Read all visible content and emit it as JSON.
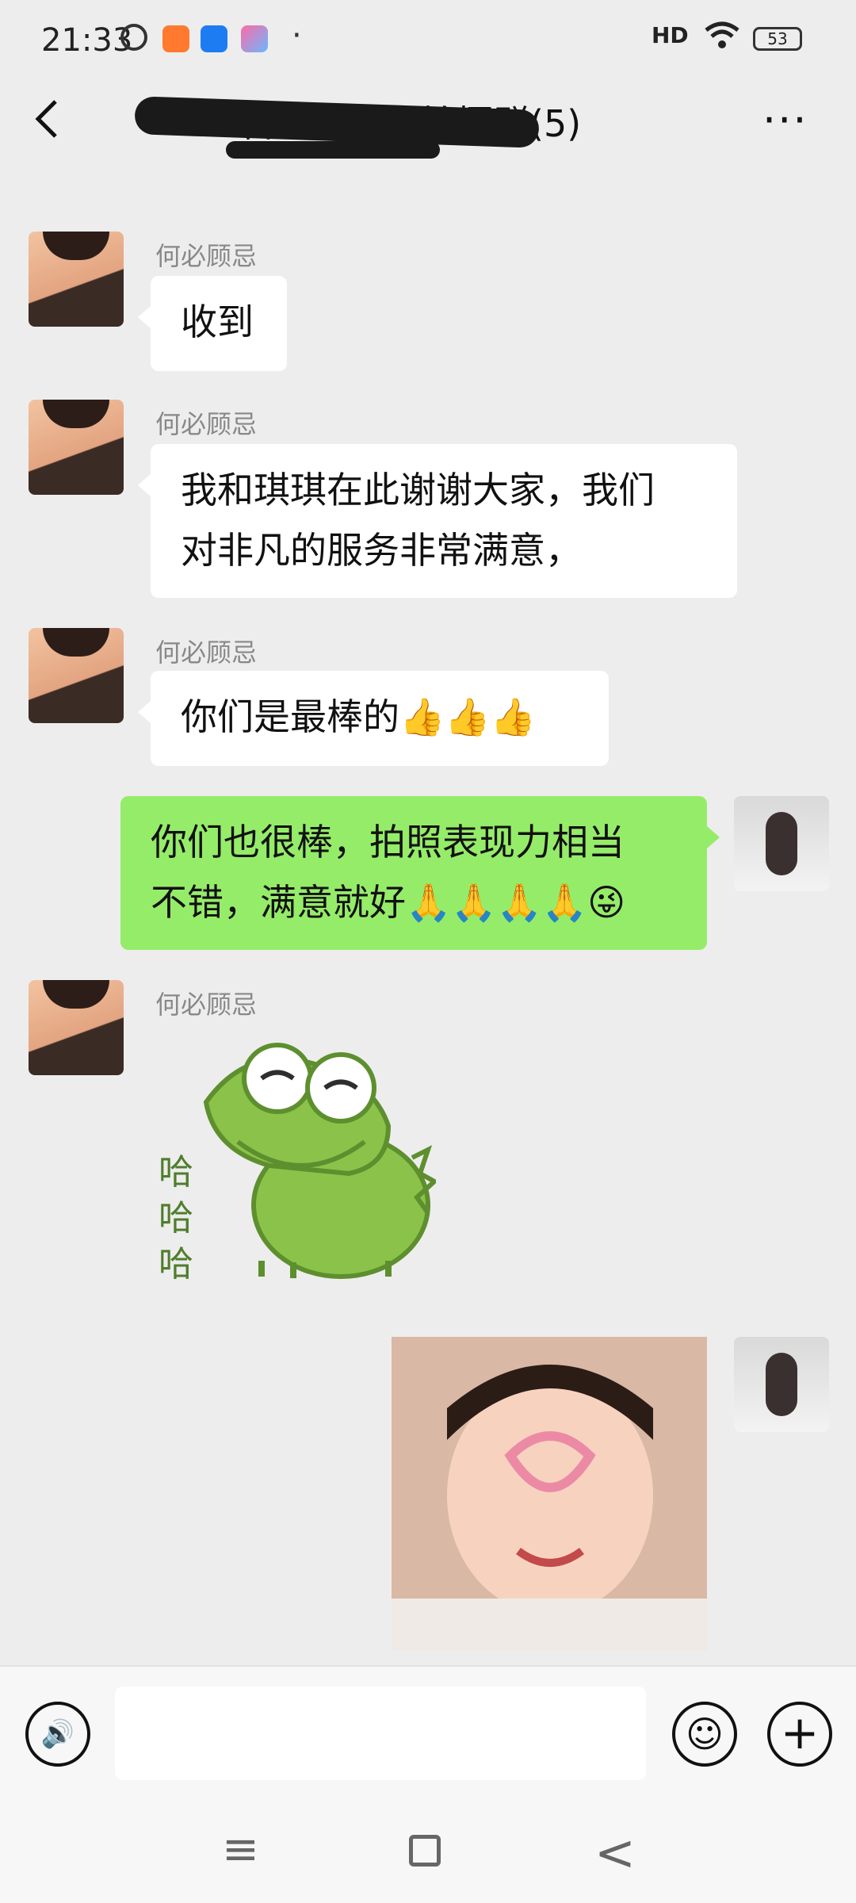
{
  "status_bar": {
    "time": "21:33",
    "signal_label": "HD",
    "battery": "53",
    "dot": "·"
  },
  "header": {
    "title": "石中明幸福拍摄群(5)",
    "back_icon": "‹",
    "more_icon": "···"
  },
  "messages": [
    {
      "side": "left",
      "sender": "何必顾忌",
      "text": "收到"
    },
    {
      "side": "left",
      "sender": "何必顾忌",
      "text_line1": "我和琪琪在此谢谢大家，我们",
      "text_line2": "对非凡的服务非常满意，"
    },
    {
      "side": "left",
      "sender": "何必顾忌",
      "text": "你们是最棒的👍👍👍"
    },
    {
      "side": "right",
      "text_line1": "你们也很棒，拍照表现力相当",
      "text_line2": "不错，满意就好🙏🙏🙏🙏😜"
    },
    {
      "side": "left",
      "sender": "何必顾忌",
      "sticker": "哈哈哈"
    },
    {
      "side": "right",
      "image": "girl-heart-photo"
    }
  ],
  "input_bar": {
    "voice_icon": "🔊",
    "text_value": "",
    "emoji_icon": "☺",
    "plus_icon": "+"
  },
  "nav_bar": {
    "menu_icon": "≡",
    "back_icon": "<"
  }
}
